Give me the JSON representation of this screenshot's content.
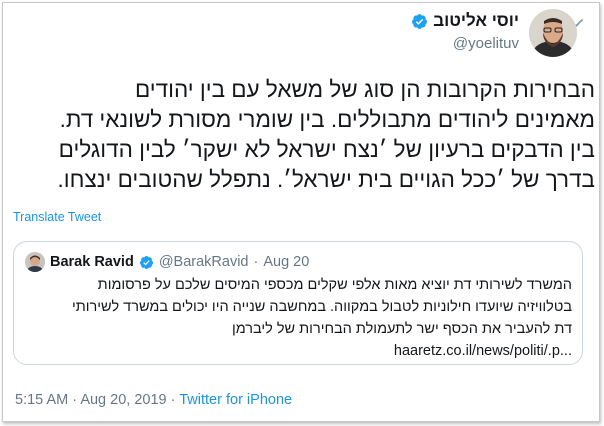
{
  "author": {
    "name": "יוסי אליטוב",
    "handle": "@yoelituv",
    "verified": true
  },
  "tweet": {
    "lines": [
      "הבחירות הקרובות הן סוג של משאל עם בין יהודים",
      "מאמינים ליהודים מתבוללים. בין שומרי מסורת לשונאי דת.",
      "בין הדבקים ברעיון של ׳נצח ישראל לא ישקר׳ לבין הדוגלים",
      "בדרך של ׳ככל הגויים בית ישראל׳. נתפלל שהטובים ינצחו."
    ],
    "translate_label": "Translate Tweet"
  },
  "quote": {
    "name": "Barak Ravid",
    "handle": "@BarakRavid",
    "separator": "·",
    "date": "Aug 20",
    "lines": [
      "המשרד לשירותי דת יוציא מאות אלפי שקלים מכספי המיסים שלכם על פרסומות",
      "בטלוויזיה שיועדו חילוניות לטבול במקווה. במחשבה שנייה היו יכולים במשרד לשירותי",
      "דת להעביר את הכסף ישר לתעמולת הבחירות של ליברמן"
    ],
    "link": "haaretz.co.il/news/politi/.p..."
  },
  "footer": {
    "time": "5:15 AM",
    "separator": "·",
    "date": "Aug 20, 2019",
    "app": "Twitter for iPhone"
  },
  "colors": {
    "accent": "#1b95e0",
    "verified": "#1da1f2",
    "muted": "#657786",
    "text": "#14171a",
    "border": "#ccd6dd"
  },
  "icons": {
    "verified": "verified-badge-icon",
    "menu": "chevron-down-icon"
  }
}
